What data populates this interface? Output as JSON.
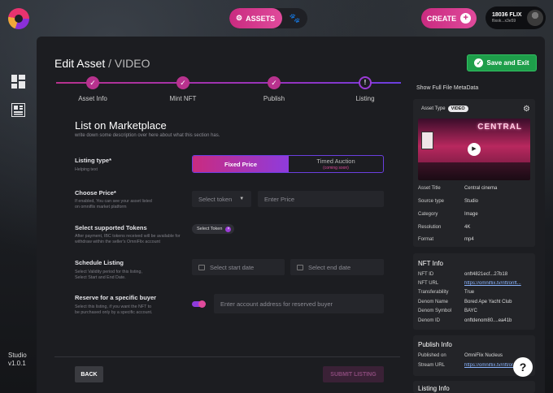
{
  "brand": {
    "accent": "#c92b80",
    "accent2": "#8f3bdc",
    "success": "#1e9e4a"
  },
  "topbar": {
    "assets_label": "ASSETS",
    "create_label": "CREATE",
    "user_name": "18036 FLIX",
    "user_address": "flixok...x3e59"
  },
  "sidebar": {
    "studio_label": "Studio",
    "version": "v1.0.1"
  },
  "page": {
    "title": "Edit Asset",
    "subtitle": "/ VIDEO",
    "save_exit_label": "Save and Exit"
  },
  "stepper": {
    "steps": [
      {
        "label": "Asset Info",
        "state": "done"
      },
      {
        "label": "Mint NFT",
        "state": "done"
      },
      {
        "label": "Publish",
        "state": "done"
      },
      {
        "label": "Listing",
        "state": "current"
      }
    ]
  },
  "form": {
    "title": "List on Marketplace",
    "description": "write down some description over here about what this section has.",
    "listing_type": {
      "label": "Listing type*",
      "help": "Helping text",
      "option_selected": "Fixed Price",
      "option_other": "Timed Auction",
      "option_other_note": "(coming soon)"
    },
    "price": {
      "label": "Choose Price*",
      "help_line1": "If enabled, You can see your asset listed",
      "help_line2": "on omniflix market platform",
      "token_placeholder": "Select token",
      "amount_placeholder": "Enter Price"
    },
    "tokens": {
      "label": "Select supported Tokens",
      "help_line1": "After payment, IBC tokens received will be available for",
      "help_line2": "withdraw within the seller's OmniFlix account",
      "chip_label": "Select Token"
    },
    "schedule": {
      "label": "Schedule Listing",
      "help_line1": "Select Validity period for this listing,",
      "help_line2": "Select Start and End Date.",
      "start_placeholder": "Select start date",
      "end_placeholder": "Select end date"
    },
    "reserve": {
      "label": "Reserve for a specific buyer",
      "help_line1": "Select this listing, if you want the NFT to",
      "help_line2": "be purchased only by a specific account.",
      "address_placeholder": "Enter account address for reserved buyer",
      "enabled": true
    },
    "back_label": "BACK",
    "submit_label": "SUBMIT LISTING"
  },
  "metadata": {
    "show_label": "Show Full File MetaData",
    "asset_type_label": "Asset Type",
    "asset_type_value": "VIDEO",
    "thumbnail_sign": "CENTRAL",
    "rows": [
      {
        "key": "Asset Title",
        "value": "Central cinema"
      },
      {
        "key": "Source type",
        "value": "Studio"
      },
      {
        "key": "Category",
        "value": "Image"
      },
      {
        "key": "Resolution",
        "value": "4K"
      },
      {
        "key": "Format",
        "value": "mp4"
      }
    ]
  },
  "nft_info": {
    "title": "NFT Info",
    "rows": [
      {
        "key": "NFT ID",
        "value": "onft4821ecf...27b18"
      },
      {
        "key": "NFT URL",
        "value": "https://omniflix.tv/nft/onft..."
      },
      {
        "key": "Transferability",
        "value": "True"
      },
      {
        "key": "Denom Name",
        "value": "Bored Ape Yacht Club"
      },
      {
        "key": "Denom Symbol",
        "value": "BAYC"
      },
      {
        "key": "Denom ID",
        "value": "onftdenom80....ea41b"
      }
    ]
  },
  "publish_info": {
    "title": "Publish Info",
    "rows": [
      {
        "key": "Published on",
        "value": "OmniFlix Nucleus"
      },
      {
        "key": "Stream URL",
        "value": "https://omniflix.tv/nft/onft..."
      }
    ]
  },
  "listing_info": {
    "title": "Listing Info"
  },
  "help_label": "?"
}
